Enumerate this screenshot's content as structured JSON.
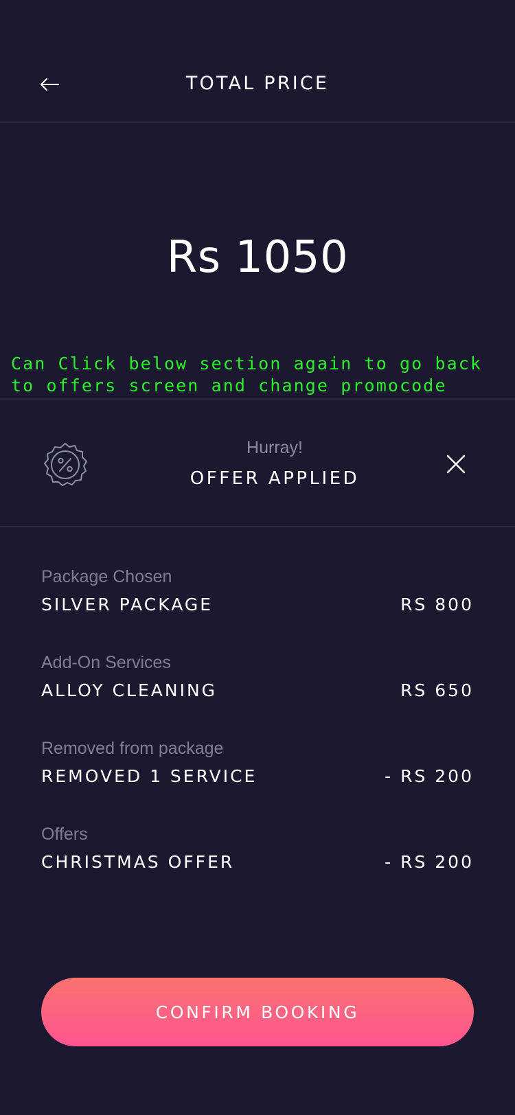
{
  "header": {
    "title": "TOTAL PRICE",
    "back_icon": "arrow-left-icon"
  },
  "total": {
    "amount": "Rs 1050"
  },
  "annotation": {
    "text": "Can Click below section again to go back to offers screen and change promocode",
    "color": "#2af02a"
  },
  "offer": {
    "icon": "percent-badge-icon",
    "greeting": "Hurray!",
    "status": "OFFER APPLIED",
    "close_icon": "close-icon"
  },
  "breakdown": [
    {
      "label": "Package Chosen",
      "name": "SILVER PACKAGE",
      "price": "RS 800"
    },
    {
      "label": "Add-On Services",
      "name": "ALLOY CLEANING",
      "price": "RS 650"
    },
    {
      "label": "Removed from package",
      "name": "REMOVED 1 SERVICE",
      "price": "- RS 200"
    },
    {
      "label": "Offers",
      "name": "CHRISTMAS OFFER",
      "price": "- RS 200"
    }
  ],
  "cta": {
    "label": "CONFIRM BOOKING",
    "gradient_start": "#f9726f",
    "gradient_end": "#fe5590"
  },
  "colors": {
    "background": "#1c1830",
    "divider": "#2c2842",
    "muted_text": "#7f7e95"
  }
}
